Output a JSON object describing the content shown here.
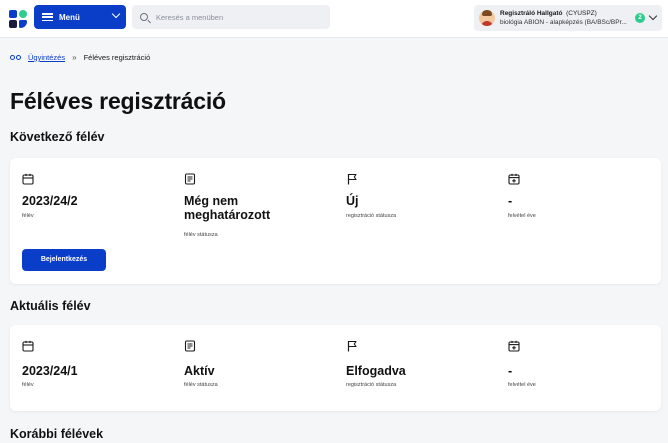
{
  "header": {
    "logo_colors": [
      "#0a3ec8",
      "#2ecc8f",
      "#1a1a3a",
      "#0a3ec8"
    ],
    "menu_label": "Menü",
    "search_placeholder": "Keresés a menüben",
    "user": {
      "name": "Regisztráló Hallgató",
      "code": "(CYUSPZ)",
      "program": "biológia ABION - alapképzés (BA/BSc/BPr...",
      "notification_count": "2"
    }
  },
  "breadcrumb": {
    "link": "Ügyintézés",
    "separator": "»",
    "current": "Féléves regisztráció"
  },
  "page_title": "Féléves regisztráció",
  "sections": {
    "next": {
      "title": "Következő félév",
      "semester_value": "2023/24/2",
      "semester_caption": "félév",
      "status_value": "Még nem meghatározott",
      "status_caption": "félév státusza",
      "reg_value": "Új",
      "reg_caption": "regisztráció státusza",
      "enroll_value": "-",
      "enroll_caption": "felvétel éve",
      "button_label": "Bejelentkezés"
    },
    "current": {
      "title": "Aktuális félév",
      "semester_value": "2023/24/1",
      "semester_caption": "félév",
      "status_value": "Aktív",
      "status_caption": "félév státusza",
      "reg_value": "Elfogadva",
      "reg_caption": "regisztráció státusza",
      "enroll_value": "-",
      "enroll_caption": "felvétel éve"
    },
    "previous": {
      "title": "Korábbi félévek"
    }
  },
  "colors": {
    "accent": "#0a3ec8",
    "badge": "#2ecc8f"
  }
}
